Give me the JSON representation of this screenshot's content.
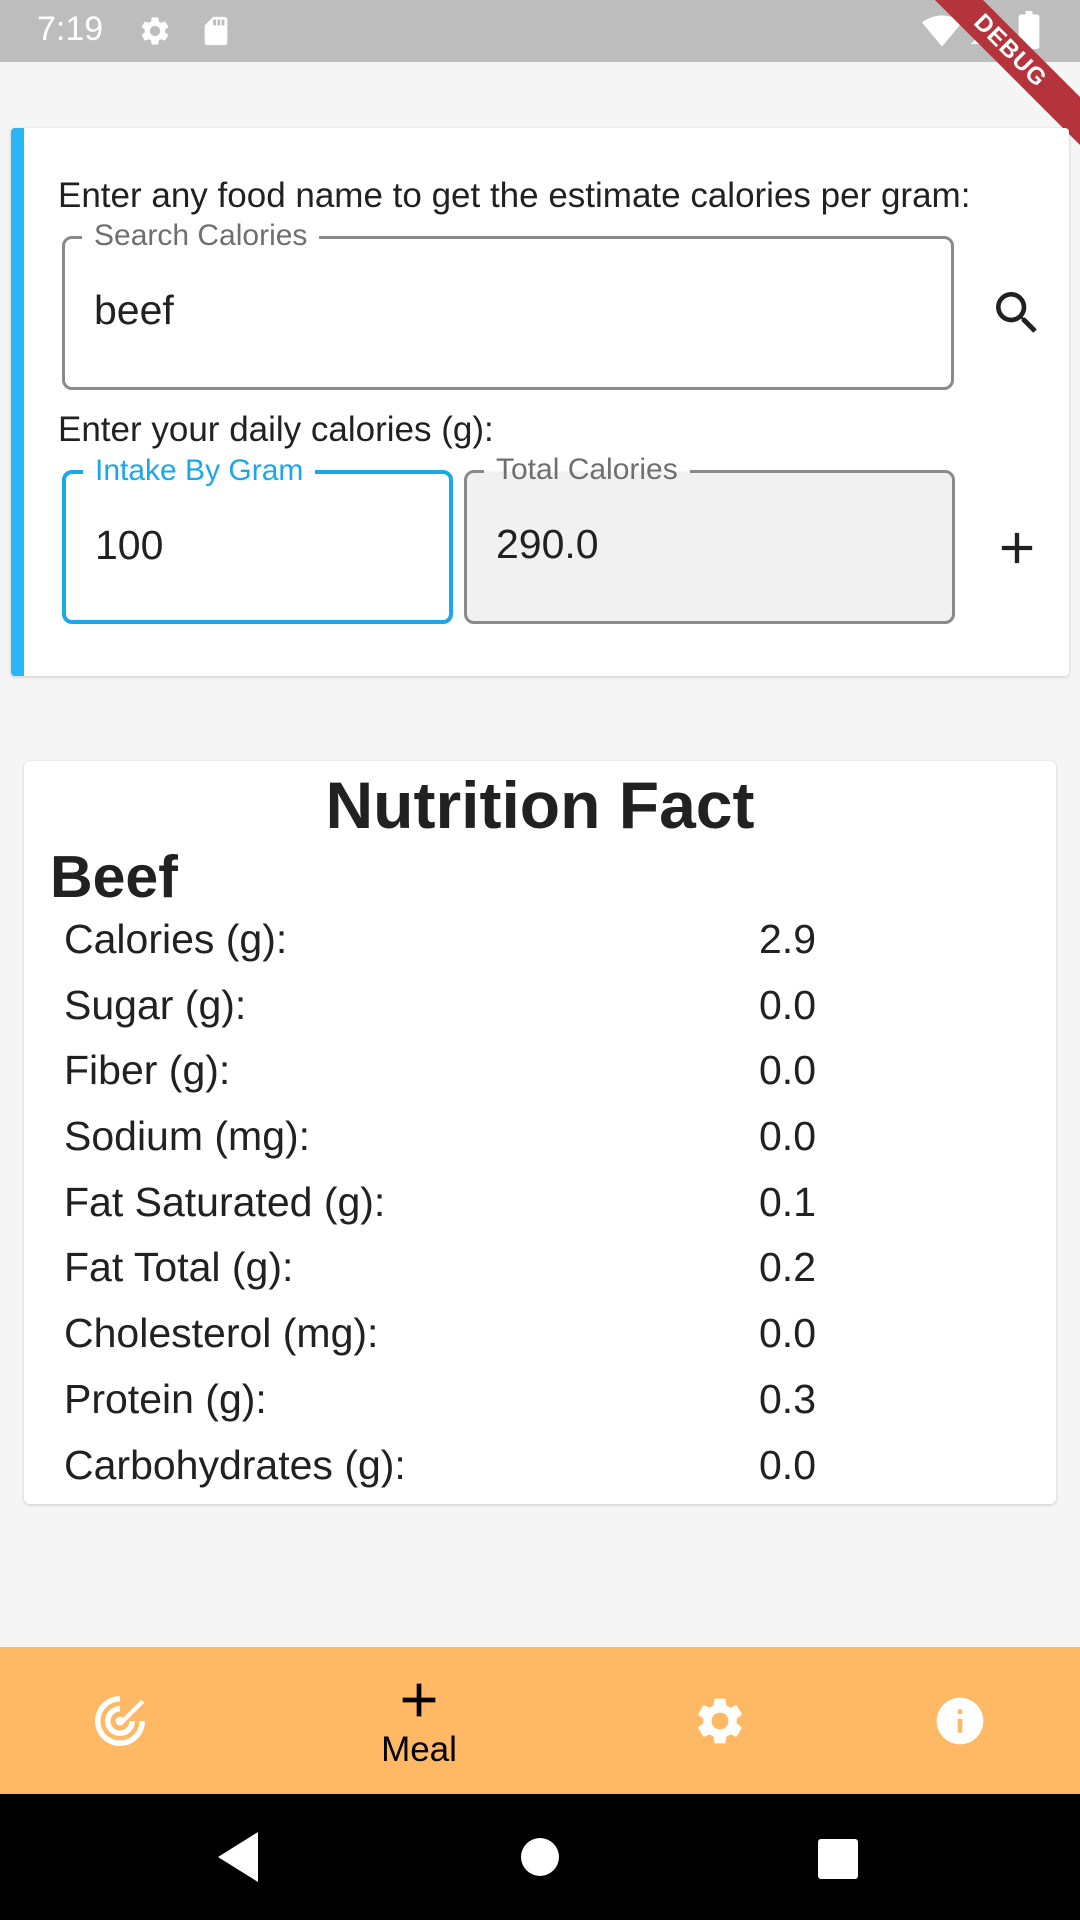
{
  "status_bar": {
    "time": "7:19",
    "icons": [
      "gear-icon",
      "sd-card-icon",
      "wifi-icon",
      "signal-icon",
      "battery-icon"
    ],
    "debug_label": "DEBUG"
  },
  "input_card": {
    "accent_color": "#29b6f6",
    "prompt_food": "Enter any food name to get the estimate calories per gram:",
    "search_field": {
      "label": "Search Calories",
      "value": "beef"
    },
    "prompt_daily": "Enter your daily calories (g):",
    "intake_field": {
      "label": "Intake By Gram",
      "value": "100"
    },
    "total_field": {
      "label": "Total Calories",
      "value": "290.0"
    },
    "search_icon": "search-icon",
    "add_icon": "plus-icon"
  },
  "nutrition": {
    "title": "Nutrition Fact",
    "food_name": "Beef",
    "rows": [
      {
        "label": "Calories (g):",
        "value": "2.9"
      },
      {
        "label": "Sugar (g):",
        "value": "0.0"
      },
      {
        "label": "Fiber (g):",
        "value": "0.0"
      },
      {
        "label": "Sodium (mg):",
        "value": "0.0"
      },
      {
        "label": "Fat Saturated (g):",
        "value": "0.1"
      },
      {
        "label": "Fat Total (g):",
        "value": "0.2"
      },
      {
        "label": "Cholesterol (mg):",
        "value": "0.0"
      },
      {
        "label": "Protein (g):",
        "value": "0.3"
      },
      {
        "label": "Carbohydrates (g):",
        "value": "0.0"
      }
    ]
  },
  "bottom_nav": {
    "background": "#ffb863",
    "items": [
      {
        "icon": "dashboard-icon",
        "label": ""
      },
      {
        "icon": "plus-icon",
        "label": "Meal"
      },
      {
        "icon": "gear-icon",
        "label": ""
      },
      {
        "icon": "info-icon",
        "label": ""
      }
    ]
  },
  "system_nav": {
    "icons": [
      "back-icon",
      "home-icon",
      "recents-icon"
    ]
  }
}
